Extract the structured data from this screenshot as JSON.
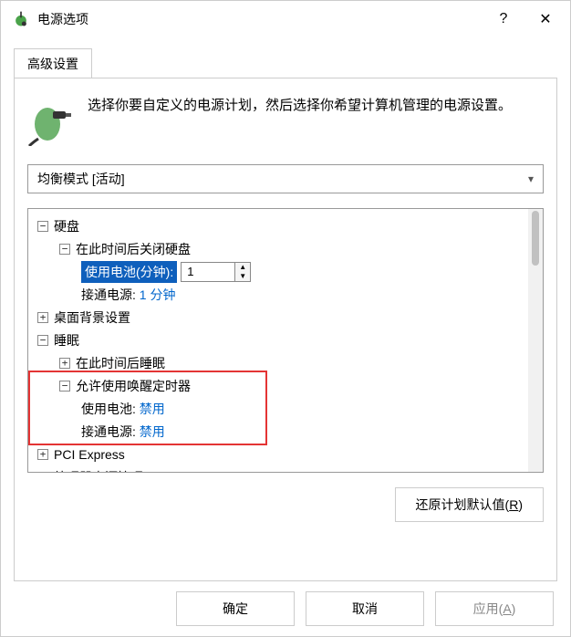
{
  "window": {
    "title": "电源选项",
    "help": "?",
    "close": "✕"
  },
  "tabs": {
    "advanced": "高级设置"
  },
  "intro": {
    "text": "选择你要自定义的电源计划，然后选择你希望计算机管理的电源设置。"
  },
  "plan_select": {
    "selected": "均衡模式 [活动]"
  },
  "tree": {
    "hard_disk": "硬盘",
    "turn_off_after": "在此时间后关闭硬盘",
    "on_battery_label_min": "使用电池(分钟):",
    "on_battery_value": "1",
    "plugged_in_label": "接通电源:",
    "plugged_in_value": "1 分钟",
    "desktop_bg": "桌面背景设置",
    "sleep": "睡眠",
    "sleep_after": "在此时间后睡眠",
    "wake_timers": "允许使用唤醒定时器",
    "wt_battery_label": "使用电池:",
    "wt_battery_value": "禁用",
    "wt_plugged_label": "接通电源:",
    "wt_plugged_value": "禁用",
    "pci_express": "PCI Express",
    "cpu_power": "处理器电源管理"
  },
  "buttons": {
    "restore_prefix": "还原计划默认值(",
    "restore_key": "R",
    "restore_suffix": ")",
    "ok": "确定",
    "cancel": "取消",
    "apply_prefix": "应用(",
    "apply_key": "A",
    "apply_suffix": ")"
  }
}
